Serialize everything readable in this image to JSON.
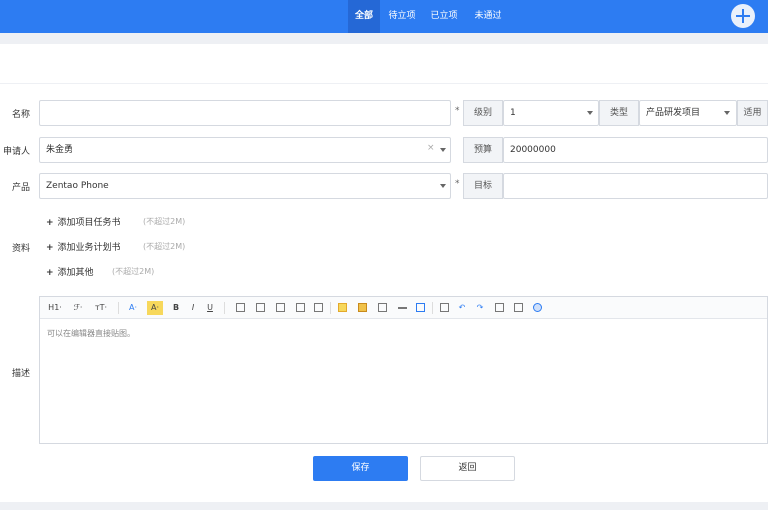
{
  "nav": {
    "tabs": [
      {
        "label": "全部"
      },
      {
        "label": "待立项"
      },
      {
        "label": "已立项"
      },
      {
        "label": "未通过"
      }
    ]
  },
  "form": {
    "name": {
      "label": "名称",
      "value": ""
    },
    "level": {
      "label": "级别",
      "value": "1"
    },
    "type": {
      "label": "类型",
      "value": "产品研发项目"
    },
    "apply": {
      "label": "适用"
    },
    "applicant": {
      "label": "申请人",
      "value": "朱金勇"
    },
    "budget": {
      "label": "预算",
      "value": "20000000"
    },
    "product": {
      "label": "产品",
      "value": "Zentao Phone"
    },
    "goal": {
      "label": "目标",
      "value": ""
    },
    "attachments": {
      "label": "资料",
      "items": [
        {
          "label": "添加项目任务书",
          "hint": "(不超过2M)"
        },
        {
          "label": "添加业务计划书",
          "hint": "(不超过2M)"
        },
        {
          "label": "添加其他",
          "hint": "(不超过2M)"
        }
      ]
    },
    "description": {
      "label": "描述",
      "placeholder": "可以在编辑器直接贴图。"
    }
  },
  "editor_toolbar": {
    "heading": "H1·",
    "font_family": "ℱ·",
    "font_size": "ᴛT·",
    "font_color": "A·",
    "bg_color": "A·",
    "bold": "B",
    "italic": "I",
    "underline": "U"
  },
  "actions": {
    "save": "保存",
    "back": "返回"
  }
}
